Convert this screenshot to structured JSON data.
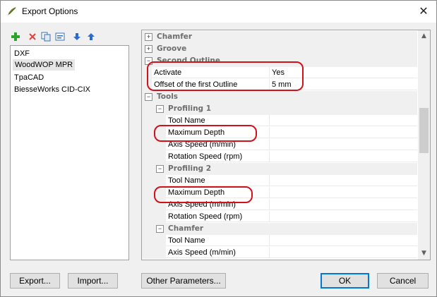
{
  "window": {
    "title": "Export Options"
  },
  "icons": {
    "app": "woodwop-feather-icon",
    "close": "close-icon",
    "add": "add-icon",
    "delete": "delete-icon",
    "copy": "copy-icon",
    "properties": "properties-icon",
    "move_down": "arrow-down-icon",
    "move_up": "arrow-up-icon"
  },
  "left_list": {
    "items": [
      "DXF",
      "WoodWOP MPR",
      "TpaCAD",
      "BiesseWorks CID-CIX"
    ],
    "selected": "WoodWOP MPR"
  },
  "properties": {
    "chamfer_group": "Chamfer",
    "groove_group": "Groove",
    "second_outline_group": "Second Outline",
    "activate": {
      "name": "Activate",
      "value": "Yes"
    },
    "offset": {
      "name": "Offset of the first Outline",
      "value": "5 mm"
    },
    "tools_group": "Tools",
    "profiling1": {
      "label": "Profiling 1",
      "rows": [
        "Tool Name",
        "Maximum Depth",
        "Axis Speed (m/min)",
        "Rotation Speed (rpm)"
      ]
    },
    "profiling2": {
      "label": "Profiling 2",
      "rows": [
        "Tool Name",
        "Maximum Depth",
        "Axis Speed (m/min)",
        "Rotation Speed (rpm)"
      ]
    },
    "tool_chamfer": {
      "label": "Chamfer",
      "rows": [
        "Tool Name",
        "Axis Speed (m/min)"
      ]
    }
  },
  "buttons": {
    "export": "Export...",
    "import": "Import...",
    "other_parameters": "Other Parameters...",
    "ok": "OK",
    "cancel": "Cancel"
  },
  "colors": {
    "annotation": "#d0121b",
    "default_button_border": "#0078d7"
  }
}
